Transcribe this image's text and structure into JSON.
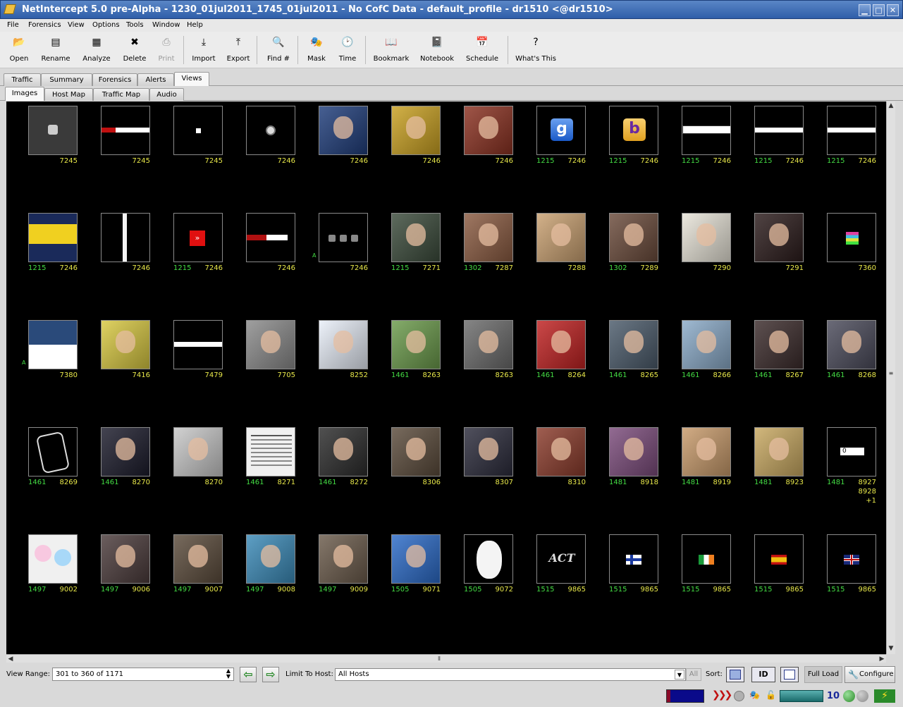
{
  "window": {
    "title": "NetIntercept 5.0 pre-Alpha - 1230_01jul2011_1745_01jul2011 - No CofC Data - default_profile - dr1510 <@dr1510>",
    "minimize": "▁",
    "maximize": "□",
    "close": "✕"
  },
  "menu": [
    "File",
    "Forensics",
    "View",
    "Options",
    "Tools",
    "Window",
    "Help"
  ],
  "toolbar": [
    {
      "label": "Open",
      "icon": "folder-open-icon",
      "glyph": "📂",
      "enabled": true
    },
    {
      "label": "Rename",
      "icon": "rename-icon",
      "glyph": "▤",
      "enabled": true
    },
    {
      "label": "Analyze",
      "icon": "analyze-icon",
      "glyph": "▦",
      "enabled": true
    },
    {
      "label": "Delete",
      "icon": "delete-icon",
      "glyph": "✖",
      "enabled": true
    },
    {
      "label": "Print",
      "icon": "print-icon",
      "glyph": "⎙",
      "enabled": false
    },
    {
      "label": "Import",
      "icon": "import-icon",
      "glyph": "⤓",
      "enabled": true
    },
    {
      "label": "Export",
      "icon": "export-icon",
      "glyph": "⤒",
      "enabled": true
    },
    {
      "label": "Find #",
      "icon": "find-icon",
      "glyph": "🔍",
      "enabled": true
    },
    {
      "label": "Mask",
      "icon": "mask-icon",
      "glyph": "🎭",
      "enabled": true
    },
    {
      "label": "Time",
      "icon": "clock-icon",
      "glyph": "🕑",
      "enabled": true
    },
    {
      "label": "Bookmark",
      "icon": "bookmark-icon",
      "glyph": "📖",
      "enabled": true
    },
    {
      "label": "Notebook",
      "icon": "notebook-icon",
      "glyph": "📓",
      "enabled": true
    },
    {
      "label": "Schedule",
      "icon": "schedule-icon",
      "glyph": "📅",
      "enabled": true
    },
    {
      "label": "What's This",
      "icon": "help-pointer-icon",
      "glyph": "?",
      "enabled": true
    }
  ],
  "tabs_main": [
    "Traffic",
    "Summary",
    "Forensics",
    "Alerts",
    "Views"
  ],
  "tabs_main_active": "Views",
  "tabs_sub": [
    "Images",
    "Host Map",
    "Traffic Map",
    "Audio"
  ],
  "tabs_sub_active": "Images",
  "thumbnails": [
    {
      "g": "",
      "y": "7245",
      "c": "#3a3a3a",
      "kind": "tiny-icon"
    },
    {
      "g": "",
      "y": "7245",
      "c": "#000",
      "kind": "banner-red"
    },
    {
      "g": "",
      "y": "7245",
      "c": "#000",
      "kind": "dot"
    },
    {
      "g": "",
      "y": "7246",
      "c": "#000",
      "kind": "small-round"
    },
    {
      "g": "",
      "y": "7246",
      "c": "#1e3c7a",
      "kind": "photo"
    },
    {
      "g": "",
      "y": "7246",
      "c": "#c9a020",
      "kind": "photo"
    },
    {
      "g": "",
      "y": "7246",
      "c": "#8a3020",
      "kind": "photo"
    },
    {
      "g": "1215",
      "y": "7246",
      "c": "#000",
      "kind": "google"
    },
    {
      "g": "1215",
      "y": "7246",
      "c": "#000",
      "kind": "bing"
    },
    {
      "g": "1215",
      "y": "7246",
      "c": "#000",
      "kind": "banner-white-text"
    },
    {
      "g": "1215",
      "y": "7246",
      "c": "#000",
      "kind": "banner-white"
    },
    {
      "g": "1215",
      "y": "7246",
      "c": "#000",
      "kind": "banner-white"
    },
    {
      "g": "1215",
      "y": "7246",
      "c": "#1a2a5a",
      "kind": "yellow-logo"
    },
    {
      "g": "",
      "y": "7246",
      "c": "#000",
      "kind": "white-bar"
    },
    {
      "g": "1215",
      "y": "7246",
      "c": "#000",
      "kind": "red-button"
    },
    {
      "g": "",
      "y": "7246",
      "c": "#000",
      "kind": "blogs"
    },
    {
      "g": "",
      "y": "7246",
      "c": "#000",
      "kind": "three-dots",
      "mark": "A"
    },
    {
      "g": "1215",
      "y": "7271",
      "c": "#3a4a3a",
      "kind": "photo"
    },
    {
      "g": "1302",
      "y": "7287",
      "c": "#8a5a40",
      "kind": "photo"
    },
    {
      "g": "",
      "y": "7288",
      "c": "#c9a070",
      "kind": "photo"
    },
    {
      "g": "1302",
      "y": "7289",
      "c": "#6a4a3a",
      "kind": "photo"
    },
    {
      "g": "",
      "y": "7290",
      "c": "#e8e4d8",
      "kind": "photo"
    },
    {
      "g": "",
      "y": "7291",
      "c": "#2a1a1a",
      "kind": "photo"
    },
    {
      "g": "",
      "y": "7360",
      "c": "#000",
      "kind": "stripes"
    },
    {
      "g": "",
      "y": "7380",
      "c": "#2a4a7a",
      "kind": "loans",
      "mark": "A"
    },
    {
      "g": "",
      "y": "7416",
      "c": "#d8c840",
      "kind": "photo"
    },
    {
      "g": "",
      "y": "7479",
      "c": "#000",
      "kind": "banner-white"
    },
    {
      "g": "",
      "y": "7705",
      "c": "#8a8a8a",
      "kind": "photo"
    },
    {
      "g": "",
      "y": "8252",
      "c": "#e8eef8",
      "kind": "photo"
    },
    {
      "g": "1461",
      "y": "8263",
      "c": "#6a9a4a",
      "kind": "photo"
    },
    {
      "g": "",
      "y": "8263",
      "c": "#6a6a6a",
      "kind": "photo"
    },
    {
      "g": "1461",
      "y": "8264",
      "c": "#c02020",
      "kind": "photo"
    },
    {
      "g": "1461",
      "y": "8265",
      "c": "#4a5a6a",
      "kind": "photo"
    },
    {
      "g": "1461",
      "y": "8266",
      "c": "#8aaac8",
      "kind": "photo"
    },
    {
      "g": "1461",
      "y": "8267",
      "c": "#3a2a2a",
      "kind": "photo"
    },
    {
      "g": "1461",
      "y": "8268",
      "c": "#4a4a5a",
      "kind": "photo"
    },
    {
      "g": "1461",
      "y": "8269",
      "c": "#000",
      "kind": "outline"
    },
    {
      "g": "1461",
      "y": "8270",
      "c": "#1a1a2a",
      "kind": "photo"
    },
    {
      "g": "",
      "y": "8270",
      "c": "#c8c8c8",
      "kind": "photo"
    },
    {
      "g": "1461",
      "y": "8271",
      "c": "#f0f0f0",
      "kind": "doc"
    },
    {
      "g": "1461",
      "y": "8272",
      "c": "#2a2a2a",
      "kind": "photo"
    },
    {
      "g": "",
      "y": "8306",
      "c": "#5a4a3a",
      "kind": "photo"
    },
    {
      "g": "",
      "y": "8307",
      "c": "#2a2a3a",
      "kind": "photo"
    },
    {
      "g": "",
      "y": "8310",
      "c": "#8a3a2a",
      "kind": "photo"
    },
    {
      "g": "1481",
      "y": "8918",
      "c": "#7a4a7a",
      "kind": "photo"
    },
    {
      "g": "1481",
      "y": "8919",
      "c": "#c89a6a",
      "kind": "photo"
    },
    {
      "g": "1481",
      "y": "8923",
      "c": "#c8a860",
      "kind": "photo"
    },
    {
      "g": "1481",
      "y": "8927",
      "c": "#000",
      "kind": "zero",
      "extra": [
        "8928",
        "+1"
      ]
    },
    {
      "g": "1497",
      "y": "9002",
      "c": "#f0f0f0",
      "kind": "cartoon"
    },
    {
      "g": "1497",
      "y": "9006",
      "c": "#4a3a3a",
      "kind": "photo"
    },
    {
      "g": "1497",
      "y": "9007",
      "c": "#5a4a3a",
      "kind": "photo"
    },
    {
      "g": "1497",
      "y": "9008",
      "c": "#3a8ab8",
      "kind": "photo"
    },
    {
      "g": "1497",
      "y": "9009",
      "c": "#6a5a4a",
      "kind": "photo"
    },
    {
      "g": "1505",
      "y": "9071",
      "c": "#2a6ac8",
      "kind": "photo"
    },
    {
      "g": "1505",
      "y": "9072",
      "c": "#e8e8e8",
      "kind": "owl"
    },
    {
      "g": "1515",
      "y": "9865",
      "c": "#000",
      "kind": "act"
    },
    {
      "g": "1515",
      "y": "9865",
      "c": "#000",
      "kind": "flag-fi"
    },
    {
      "g": "1515",
      "y": "9865",
      "c": "#000",
      "kind": "flag-ie"
    },
    {
      "g": "1515",
      "y": "9865",
      "c": "#000",
      "kind": "flag-es"
    },
    {
      "g": "1515",
      "y": "9865",
      "c": "#000",
      "kind": "flag-uk"
    }
  ],
  "bottom": {
    "view_range_label": "View Range:",
    "view_range_value": "301 to 360 of 1171",
    "limit_label": "Limit To Host:",
    "limit_value": "All Hosts",
    "all_button": "All",
    "sort_label": "Sort:",
    "full_load": "Full Load",
    "configure": "Configure"
  },
  "status": {
    "count": "10"
  }
}
